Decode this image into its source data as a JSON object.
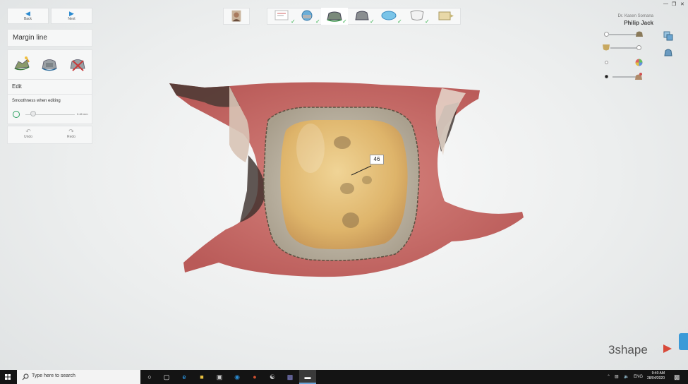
{
  "nav": {
    "back_label": "Back",
    "next_label": "Next"
  },
  "panel": {
    "title": "Margin line",
    "edit_label": "Edit",
    "smoothness_label": "Smoothness when editing",
    "smoothness_value": "0.46 mm",
    "undo_label": "Undo",
    "redo_label": "Redo",
    "tools": [
      "draw-margin-icon",
      "auto-detect-icon",
      "delete-margin-icon"
    ]
  },
  "steps": [
    {
      "icon": "order-form-icon",
      "done": true
    },
    {
      "icon": "scan-upper-icon",
      "done": true
    },
    {
      "icon": "margin-line-icon",
      "done": true,
      "active": true
    },
    {
      "icon": "scan-lower-icon",
      "done": true
    },
    {
      "icon": "bite-icon",
      "done": true
    },
    {
      "icon": "crown-icon",
      "done": true
    },
    {
      "icon": "export-icon",
      "done": false
    }
  ],
  "user": {
    "doctor": "Dr. Kasen Somana",
    "patient": "Philip Jack"
  },
  "viewer": {
    "tooth_number": "46"
  },
  "brand": {
    "logo_text": "3shape",
    "accent": "#d84a3a"
  },
  "taskbar": {
    "search_placeholder": "Type here to search",
    "language": "ENG",
    "time": "9:40 AM",
    "date": "28/04/2020"
  },
  "colors": {
    "accent_blue": "#2a8ad0",
    "check_green": "#33b04a",
    "gingiva": "#c66a66",
    "tooth": "#e8c27a"
  }
}
